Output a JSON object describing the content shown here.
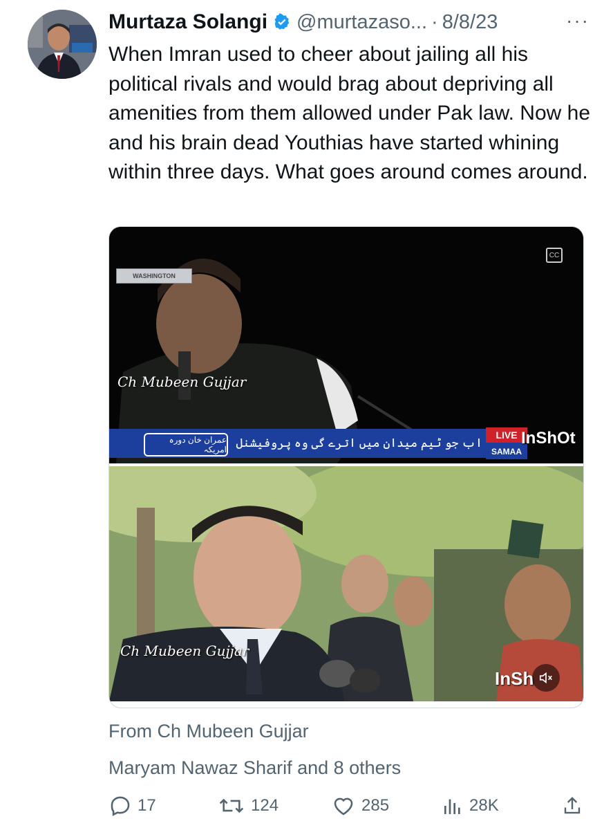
{
  "tweet": {
    "author_name": "Murtaza Solangi",
    "handle": "@murtazaso...",
    "separator": "·",
    "date": "8/8/23",
    "more_label": "···",
    "text": "When Imran used to cheer about jailing all his political rivals and would brag about depriving all amenities from them allowed under Pak law. Now he and his brain dead Youthias have started whining within three days. What goes around comes around."
  },
  "media": {
    "top_location_label": "WASHINGTON",
    "top_watermark": "Ch Mubeen Gujjar",
    "top_ticker_badge": "عمران خان دورہ امریکہ",
    "top_ticker_text": "اب جو ٹیم میدان میں اترے گی وہ پروفیشنل ہوگی",
    "top_channel_logo": "SAMAA",
    "top_live_label": "LIVE",
    "top_app_watermark": "InShOt",
    "bottom_watermark": "Ch Mubeen Gujjar",
    "bottom_app_watermark": "InSh",
    "cc_icon": "closed-captions-icon",
    "mute_icon": "muted-speaker-icon"
  },
  "attribution": {
    "from_text": "From Ch Mubeen Gujjar",
    "liked_by_text": "Maryam Nawaz Sharif and 8 others"
  },
  "actions": {
    "reply_count": "17",
    "retweet_count": "124",
    "like_count": "285",
    "views_count": "28K"
  },
  "colors": {
    "text": "#0f1419",
    "secondary": "#536471",
    "verified": "#1d9bf0",
    "border": "#cfd9de"
  }
}
